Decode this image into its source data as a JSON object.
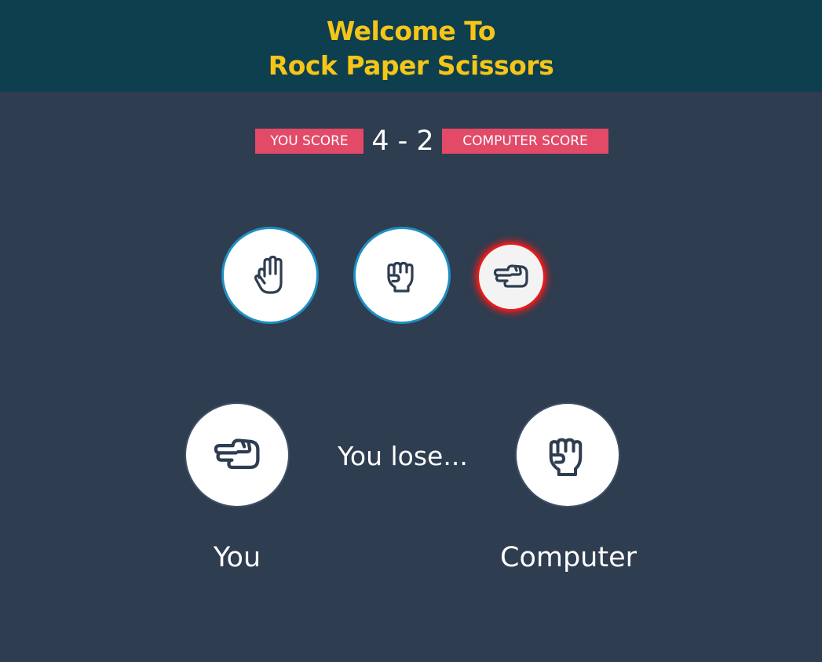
{
  "header": {
    "title_line1": "Welcome To",
    "title_line2": "Rock Paper Scissors",
    "title_color": "#f5c518",
    "background": "#0e3f4f"
  },
  "scoreboard": {
    "you_label": "YOU SCORE",
    "score": "4 - 2",
    "computer_label": "COMPUTER SCORE",
    "badge_color": "#e24a68"
  },
  "choices": [
    {
      "id": "paper",
      "icon": "hand-paper-icon",
      "selected": false
    },
    {
      "id": "rock",
      "icon": "hand-rock-icon",
      "selected": false
    },
    {
      "id": "scissors",
      "icon": "hand-scissors-icon",
      "selected": true
    }
  ],
  "result": {
    "you_hand_icon": "hand-scissors-icon",
    "computer_hand_icon": "hand-rock-icon",
    "message": "You lose...",
    "you_label": "You",
    "computer_label": "Computer"
  },
  "colors": {
    "page_background": "#2e3d50",
    "choice_border": "#1f8fc2",
    "selected_border": "#e41b1b"
  }
}
